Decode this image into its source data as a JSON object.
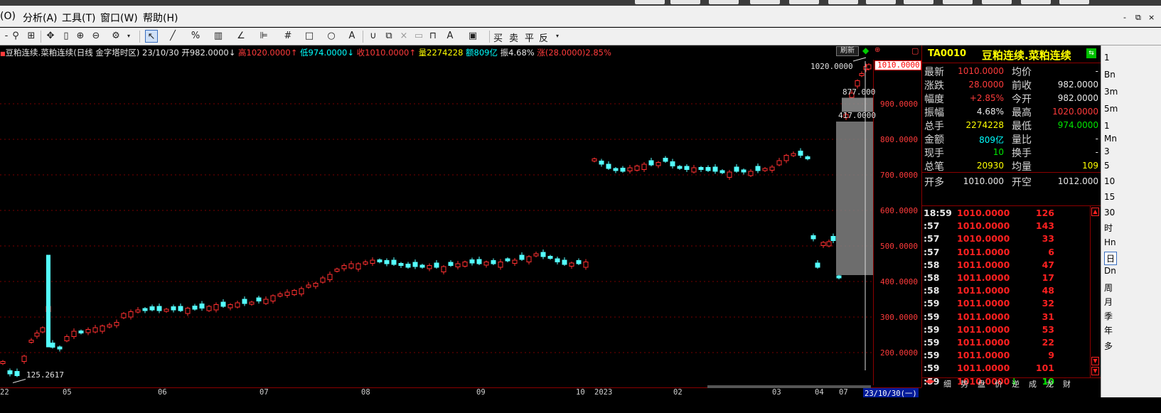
{
  "menu": {
    "items": [
      "(O)",
      "分析(A)",
      "工具(T)",
      "窗口(W)",
      "帮助(H)"
    ],
    "window_controls": [
      "-",
      "⧉",
      "×"
    ]
  },
  "toolbar": {
    "trade_buttons": [
      "买",
      "卖",
      "平",
      "反"
    ]
  },
  "info": {
    "instrument": "豆粕连续.菜粕连续(日线 金字塔时区)",
    "date": "23/10/30",
    "open": "开982.0000",
    "high": "高1020.0000",
    "low": "低974.0000",
    "close": "收1010.0000",
    "volume": "量2274228",
    "amount": "额809亿",
    "amplitude": "振4.68%",
    "change": "涨(28.0000)2.85%",
    "refresh": "刷新"
  },
  "axis": {
    "price_labels": [
      "900.0000",
      "800.0000",
      "700.0000",
      "600.0000",
      "500.0000",
      "400.0000",
      "300.0000",
      "200.0000"
    ],
    "current_price": "1010.0000",
    "annotations": [
      "1020.0000",
      "877.000",
      "417.0000",
      "125.2617"
    ],
    "date_labels": [
      "22",
      "05",
      "06",
      "07",
      "08",
      "09",
      "10",
      "2023",
      "02",
      "03",
      "04",
      "07"
    ],
    "current_date": "23/10/30(一)"
  },
  "quote": {
    "code": "TA0010",
    "name": "豆粕连续.菜粕连续",
    "rows": [
      {
        "l1": "最新",
        "v1": "1010.0000",
        "c1": "red",
        "l2": "均价",
        "v2": "-",
        "c2": "white"
      },
      {
        "l1": "涨跌",
        "v1": "28.0000",
        "c1": "red",
        "l2": "前收",
        "v2": "982.0000",
        "c2": "white"
      },
      {
        "l1": "幅度",
        "v1": "+2.85%",
        "c1": "red",
        "l2": "今开",
        "v2": "982.0000",
        "c2": "white"
      },
      {
        "l1": "振幅",
        "v1": "4.68%",
        "c1": "white",
        "l2": "最高",
        "v2": "1020.0000",
        "c2": "red"
      },
      {
        "l1": "总手",
        "v1": "2274228",
        "c1": "yel",
        "l2": "最低",
        "v2": "974.0000",
        "c2": "green"
      },
      {
        "l1": "金额",
        "v1": "809亿",
        "c1": "cyan",
        "l2": "量比",
        "v2": "-",
        "c2": "white"
      },
      {
        "l1": "现手",
        "v1": "10",
        "c1": "green",
        "l2": "换手",
        "v2": "-",
        "c2": "white"
      },
      {
        "l1": "总笔",
        "v1": "20930",
        "c1": "yel",
        "l2": "均量",
        "v2": "109",
        "c2": "yel"
      },
      {
        "l1": "开多",
        "v1": "1010.000",
        "c1": "white",
        "l2": "开空",
        "v2": "1012.000",
        "c2": "white"
      }
    ],
    "ticks": [
      {
        "t": "18:59",
        "p": "1010.0000",
        "v": "126"
      },
      {
        "t": ":57",
        "p": "1010.0000",
        "v": "143"
      },
      {
        "t": ":57",
        "p": "1010.0000",
        "v": "33"
      },
      {
        "t": ":57",
        "p": "1011.0000",
        "v": "6"
      },
      {
        "t": ":58",
        "p": "1011.0000",
        "v": "47"
      },
      {
        "t": ":58",
        "p": "1011.0000",
        "v": "17"
      },
      {
        "t": ":58",
        "p": "1011.0000",
        "v": "48"
      },
      {
        "t": ":59",
        "p": "1011.0000",
        "v": "32"
      },
      {
        "t": ":59",
        "p": "1011.0000",
        "v": "31"
      },
      {
        "t": ":59",
        "p": "1011.0000",
        "v": "53"
      },
      {
        "t": ":59",
        "p": "1011.0000",
        "v": "22"
      },
      {
        "t": ":59",
        "p": "1011.0000",
        "v": "9"
      },
      {
        "t": ":59",
        "p": "1011.0000",
        "v": "101"
      },
      {
        "t": ":59",
        "p": "1010.0000",
        "v": "10",
        "down": "↓"
      }
    ],
    "tabs": [
      "细",
      "势",
      "盘",
      "价",
      "逆",
      "成",
      "龙",
      "财"
    ]
  },
  "sidebar": {
    "items": [
      "1",
      "Bn",
      "3m",
      "5m",
      "1",
      "Mn",
      "3",
      "5",
      "10",
      "15",
      "30",
      "时",
      "Hn",
      "日",
      "Dn",
      "周",
      "月",
      "季",
      "年",
      "多"
    ]
  },
  "chart_data": {
    "type": "candlestick",
    "ylim": [
      125,
      1020
    ],
    "y_ticks": [
      200,
      300,
      400,
      500,
      600,
      700,
      800,
      900
    ],
    "last": {
      "open": 982,
      "high": 1020,
      "low": 974,
      "close": 1010
    },
    "annotated_high": 1020,
    "annotated_low": 125.2617
  }
}
